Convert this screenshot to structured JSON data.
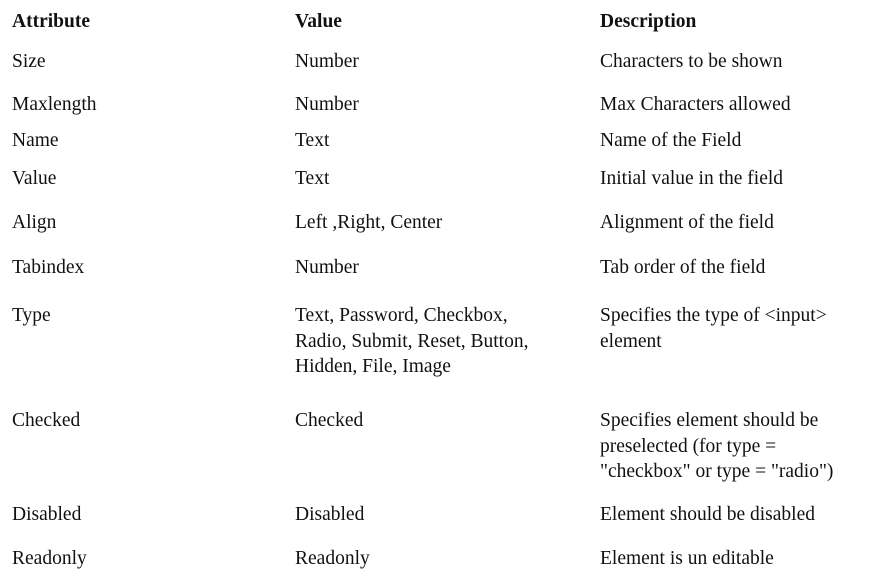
{
  "headers": {
    "attribute": "Attribute",
    "value": "Value",
    "description": "Description"
  },
  "rows": [
    {
      "attribute": "Size",
      "value": "Number",
      "description": "Characters to be shown"
    },
    {
      "attribute": "Maxlength",
      "value": "Number",
      "description": "Max Characters allowed"
    },
    {
      "attribute": "Name",
      "value": "Text",
      "description": "Name of the Field"
    },
    {
      "attribute": "Value",
      "value": "Text",
      "description": "Initial value in the field"
    },
    {
      "attribute": "Align",
      "value": "Left ,Right, Center",
      "description": "Alignment of the field"
    },
    {
      "attribute": "Tabindex",
      "value": "Number",
      "description": "Tab order of the field"
    },
    {
      "attribute": "Type",
      "value": "Text, Password, Checkbox,\nRadio, Submit, Reset, Button,\nHidden, File, Image",
      "description": "Specifies the type of <input>\nelement"
    },
    {
      "attribute": "Checked",
      "value": "Checked",
      "description": "Specifies element should be\npreselected (for type =\n\"checkbox\" or type = \"radio\")"
    },
    {
      "attribute": "Disabled",
      "value": "Disabled",
      "description": "Element should be disabled"
    },
    {
      "attribute": "Readonly",
      "value": "Readonly",
      "description": "Element is un editable"
    }
  ]
}
